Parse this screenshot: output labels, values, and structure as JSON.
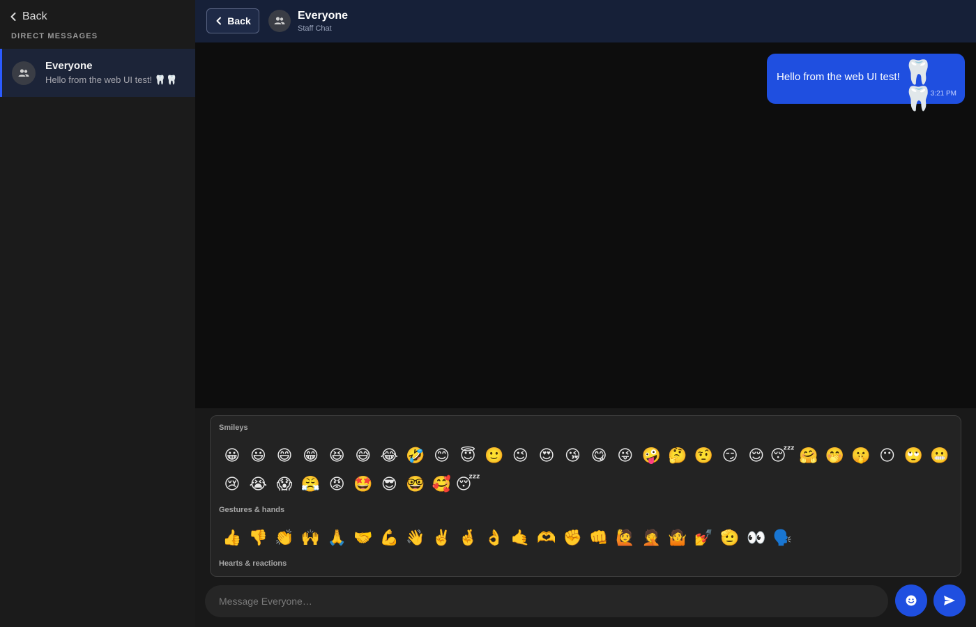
{
  "sidebar": {
    "back_label": "Back",
    "section_label": "DIRECT MESSAGES",
    "conversations": [
      {
        "name": "Everyone",
        "preview": "Hello from the web UI test! 🦷🦷"
      }
    ]
  },
  "header": {
    "back_label": "Back",
    "title": "Everyone",
    "subtitle": "Staff Chat"
  },
  "messages": [
    {
      "text": "Hello from the web UI test!",
      "emoji": "🦷🦷",
      "time": "3:21 PM"
    }
  ],
  "emoji_picker": {
    "categories": [
      {
        "label": "Smileys",
        "emojis": [
          "😀",
          "😃",
          "😄",
          "😁",
          "😆",
          "😅",
          "😂",
          "🤣",
          "😊",
          "😇",
          "🙂",
          "😉",
          "😍",
          "😘",
          "😋",
          "😜",
          "🤪",
          "🤔",
          "🤨",
          "😏",
          "😌",
          "😴",
          "🤗",
          "🤭",
          "🤫",
          "😶",
          "🙄",
          "😬",
          "😢",
          "😭",
          "😱",
          "😤",
          "😡",
          "🤩",
          "😎",
          "🤓",
          "🥰",
          "😴"
        ]
      },
      {
        "label": "Gestures & hands",
        "emojis": [
          "👍",
          "👎",
          "👏",
          "🙌",
          "🙏",
          "🤝",
          "💪",
          "👋",
          "✌️",
          "🤞",
          "👌",
          "🤙",
          "🫶",
          "✊",
          "👊",
          "🙋",
          "🤦",
          "🤷",
          "💅",
          "🫡",
          "👀",
          "🗣️"
        ]
      },
      {
        "label": "Hearts & reactions",
        "emojis": [
          "❤️",
          "🧡",
          "💛",
          "💚",
          "💙",
          "💜",
          "🖤",
          "🤍",
          "💖",
          "🔥",
          "💯",
          "💔",
          "💢",
          "💥",
          "✨",
          "⭐",
          "🌟",
          "🎉",
          "💕",
          "💗"
        ]
      }
    ]
  },
  "composer": {
    "placeholder": "Message Everyone…"
  },
  "colors": {
    "accent": "#1f4fe0",
    "sidebar_bg": "#1b1b1b",
    "header_bg": "#162038",
    "active_item_bg": "#1c2438"
  },
  "icons": {
    "back": "chevron-left-icon",
    "avatar": "people-icon",
    "emoji_toggle": "smiley-icon",
    "send": "send-icon"
  }
}
